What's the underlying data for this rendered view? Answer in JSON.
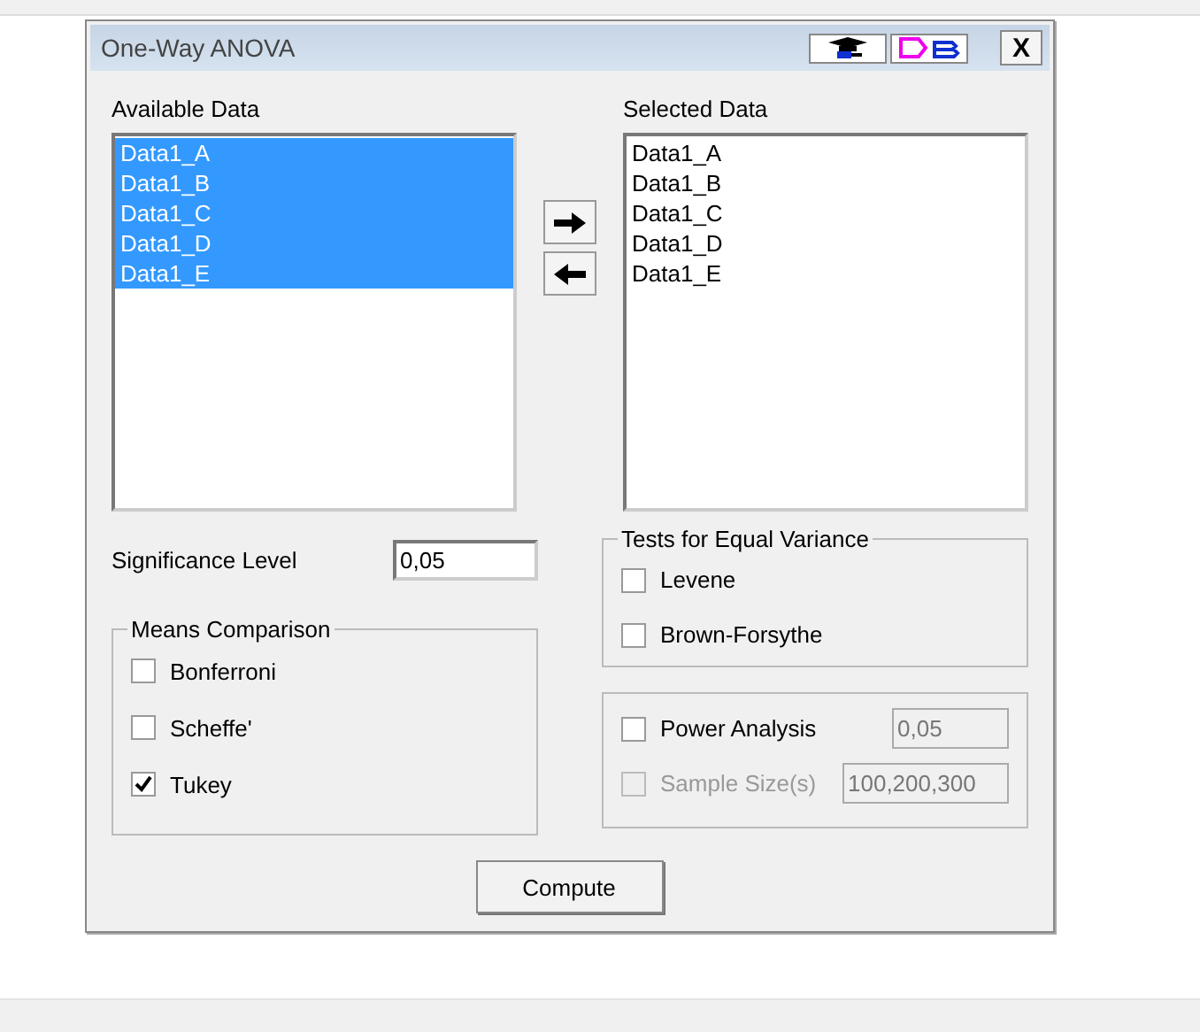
{
  "window": {
    "title": "One-Way ANOVA",
    "close": "X"
  },
  "available": {
    "label": "Available Data",
    "items": [
      {
        "text": "Data1_A",
        "selected": true
      },
      {
        "text": "Data1_B",
        "selected": true
      },
      {
        "text": "Data1_C",
        "selected": true
      },
      {
        "text": "Data1_D",
        "selected": true
      },
      {
        "text": "Data1_E",
        "selected": true
      }
    ]
  },
  "selected_data": {
    "label": "Selected Data",
    "items": [
      {
        "text": "Data1_A",
        "selected": false
      },
      {
        "text": "Data1_B",
        "selected": false
      },
      {
        "text": "Data1_C",
        "selected": false
      },
      {
        "text": "Data1_D",
        "selected": false
      },
      {
        "text": "Data1_E",
        "selected": false
      }
    ]
  },
  "significance": {
    "label": "Significance Level",
    "value": "0,05"
  },
  "means_comparison": {
    "title": "Means Comparison",
    "options": [
      {
        "label": "Bonferroni",
        "checked": false
      },
      {
        "label": "Scheffe'",
        "checked": false
      },
      {
        "label": "Tukey",
        "checked": true
      }
    ]
  },
  "equal_variance": {
    "title": "Tests for Equal Variance",
    "options": [
      {
        "label": "Levene",
        "checked": false
      },
      {
        "label": "Brown-Forsythe",
        "checked": false
      }
    ]
  },
  "power": [
    {
      "label": "Power Analysis",
      "checked": false,
      "disabled": false,
      "value": "0,05"
    },
    {
      "label": "Sample Size(s)",
      "checked": false,
      "disabled": true,
      "value": "100,200,300"
    }
  ],
  "compute": "Compute"
}
